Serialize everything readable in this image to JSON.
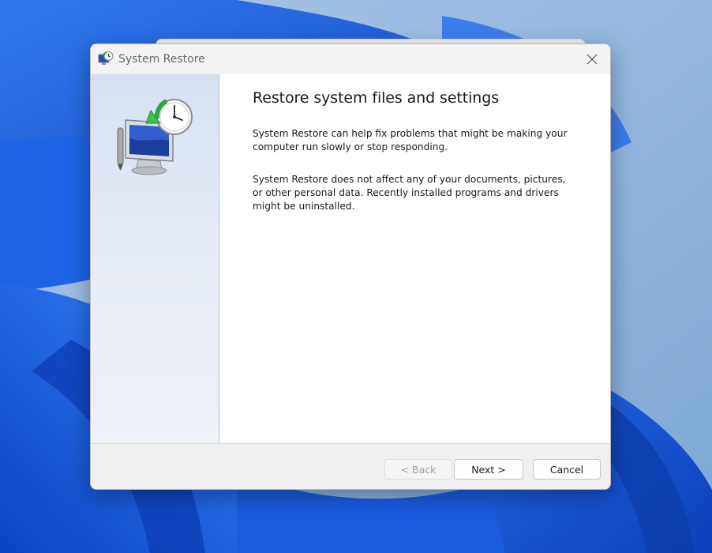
{
  "window": {
    "title": "System Restore",
    "app_icon": "system-restore-icon",
    "close_icon": "close-icon"
  },
  "sidebar": {
    "hero_icon": "system-restore-monitor-clock-icon"
  },
  "content": {
    "heading": "Restore system files and settings",
    "paragraph1": "System Restore can help fix problems that might be making your computer run slowly or stop responding.",
    "paragraph2": "System Restore does not affect any of your documents, pictures, or other personal data. Recently installed programs and drivers might be uninstalled."
  },
  "buttons": {
    "back": {
      "label": "< Back",
      "enabled": false
    },
    "next": {
      "label": "Next >",
      "enabled": true
    },
    "cancel": {
      "label": "Cancel",
      "enabled": true
    }
  },
  "colors": {
    "wallpaper_base": "#8fb5dd",
    "wallpaper_bloom": "#1656d9",
    "sidebar_top": "#d5e0f1",
    "sidebar_bottom": "#eef2f9",
    "footer": "#f0f0f0"
  }
}
